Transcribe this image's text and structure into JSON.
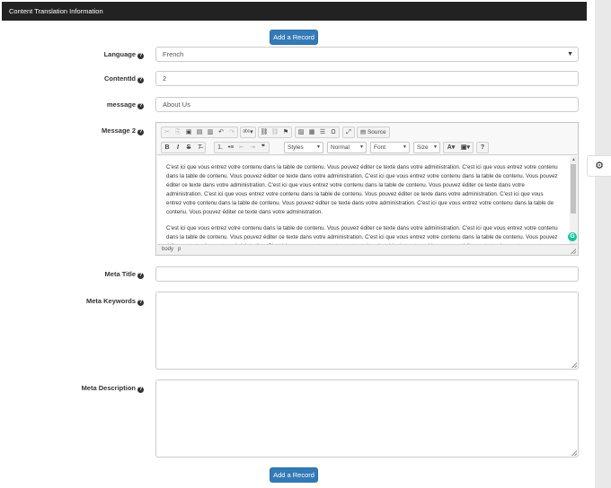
{
  "header": {
    "title": "Content Translation Information"
  },
  "buttons": {
    "add_record_top": "Add a Record",
    "add_record_bottom": "Add a Record"
  },
  "help_glyph": "?",
  "fields": {
    "language": {
      "label": "Language",
      "value": "French"
    },
    "content_id": {
      "label": "ContentId",
      "value": "2"
    },
    "message": {
      "label": "message",
      "value": "About Us"
    },
    "message2": {
      "label": "Message 2"
    },
    "meta_title": {
      "label": "Meta Title",
      "value": ""
    },
    "meta_keywords": {
      "label": "Meta Keywords",
      "value": ""
    },
    "meta_description": {
      "label": "Meta Description",
      "value": ""
    }
  },
  "editor": {
    "source_label": "Source",
    "styles_label": "Styles",
    "format_label": "Normal",
    "font_label": "Font",
    "size_label": "Size",
    "paragraph1": "C'est ici que vous entrez votre contenu dans la table de contenu. Vous pouvez éditer ce texte dans votre administration. C'est ici que vous entrez votre contenu dans la table de contenu. Vous pouvez éditer ce texte dans votre administration. C'est ici que vous entrez votre contenu dans la table de contenu. Vous pouvez éditer ce texte dans votre administration. C'est ici que vous entrez votre contenu dans la table de contenu. Vous pouvez éditer ce texte dans votre administration. C'est ici que vous entrez votre contenu dans la table de contenu. Vous pouvez éditer ce texte dans votre administration. C'est ici que vous entrez votre contenu dans la table de contenu. Vous pouvez éditer ce texte dans votre administration. C'est ici que vous entrez votre contenu dans la table de contenu. Vous pouvez éditer ce texte dans votre administration.",
    "paragraph2": "C'est ici que vous entrez votre contenu dans la table de contenu. Vous pouvez éditer ce texte dans votre administration. C'est ici que vous entrez votre contenu dans la table de contenu. Vous pouvez éditer ce texte dans votre administration. C'est ici que vous entrez votre contenu dans la table de contenu. Vous pouvez éditer ce texte dans votre administration. C'est ici que vous entrez votre contenu dans la table de contenu. Vous pouvez éditer ce texte dans votre administration.",
    "path_body": "body",
    "path_p": "p",
    "grammarly": "G"
  },
  "icons": {
    "toolbar_row1": [
      "cut-icon",
      "copy-icon",
      "paste-icon",
      "paste-text-icon",
      "paste-word-icon",
      "undo-icon",
      "redo-icon",
      "spellcheck-icon",
      "link-icon",
      "unlink-icon",
      "anchor-icon",
      "image-icon",
      "table-icon",
      "horizontal-rule-icon",
      "special-char-icon",
      "maximize-icon",
      "source-icon"
    ],
    "toolbar_row2": [
      "bold-icon",
      "italic-icon",
      "strike-icon",
      "remove-format-icon",
      "numbered-list-icon",
      "bullet-list-icon",
      "outdent-icon",
      "indent-icon",
      "blockquote-icon",
      "text-color-icon",
      "bg-color-icon",
      "help-icon"
    ],
    "gear": "gear-icon"
  },
  "colors": {
    "header_bg": "#222222",
    "primary": "#337ab7",
    "grammarly": "#15c39a"
  }
}
